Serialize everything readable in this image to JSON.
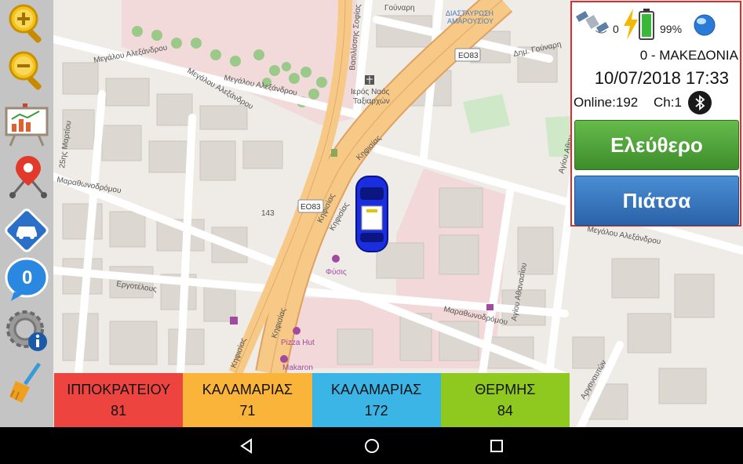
{
  "map": {
    "labels": {
      "gounari": "Γούναρη",
      "vas_sofias": "Βασιλίσσης Σοφίας",
      "diastavrosi": "ΔΙΑΣΤΑΥΡΩΣΗ",
      "amarousiou": "ΑΜΑΡΟΥΣΙΟΥ",
      "eo83_top": "ΕΟ83",
      "dim_gounari": "Δημ. Γούναρη",
      "meg_alex_1": "Μεγάλου Αλεξάνδρου",
      "meg_alex_2": "Μεγάλου Αλεξάνδρου",
      "meg_alex_3": "Μεγάλου Αλεξάνδρου",
      "meg_alex_4": "Μεγάλου Αλεξάνδρου",
      "church_1": "Ιερός Ναός",
      "church_2": "Ταξιαρχών",
      "kifisias_1": "Κηφισίας",
      "kifisias_2": "Κηφισίας",
      "kifisias_3": "Κηφισίας",
      "kifisias_4": "Κηφισίας",
      "kifisias_5": "Κηφισίας",
      "martiou": "25ης Μαρτίου",
      "marathonodromou_1": "Μαραθωνοδρόμου",
      "marathonodromou_2": "Μαραθωνοδρόμου",
      "eo83_mid": "ΕΟ83",
      "num_143": "143",
      "fysis": "Φύσις",
      "ergotelous": "Εργοτέλους",
      "agiou_athanasiou": "Αγίου Αθανασίου",
      "agiou_athanasiou_2": "Αγίου Αθαν...",
      "pizza_hut": "Pizza Hut",
      "makaron": "Makaron",
      "argonafton": "Αργοναυτών"
    }
  },
  "panel": {
    "sat_count": "0",
    "battery": "99%",
    "region": "0 - ΜΑΚΕΔΟΝΙΑ",
    "datetime": "10/07/2018 17:33",
    "online": "Online:192",
    "channel": "Ch:1",
    "btn_free": "Ελεύθερο",
    "btn_piatsa": "Πιάτσα"
  },
  "sidebar": {
    "messages_count": "0"
  },
  "zones": [
    {
      "name": "ΙΠΠΟΚΡΑΤΕΙΟΥ",
      "count": "81",
      "color": "#ee4440"
    },
    {
      "name": "ΚΑΛΑΜΑΡΙΑΣ",
      "count": "71",
      "color": "#fbb43a"
    },
    {
      "name": "ΚΑΛΑΜΑΡΙΑΣ",
      "count": "172",
      "color": "#3bb4e6"
    },
    {
      "name": "ΘΕΡΜΗΣ",
      "count": "84",
      "color": "#8fc81e"
    }
  ],
  "colors": {
    "panel_border": "#d83030",
    "btn_free": "#4ea23a",
    "btn_piatsa": "#3a78c0",
    "highway": "#f5c680",
    "car": "#1a2ee0"
  }
}
